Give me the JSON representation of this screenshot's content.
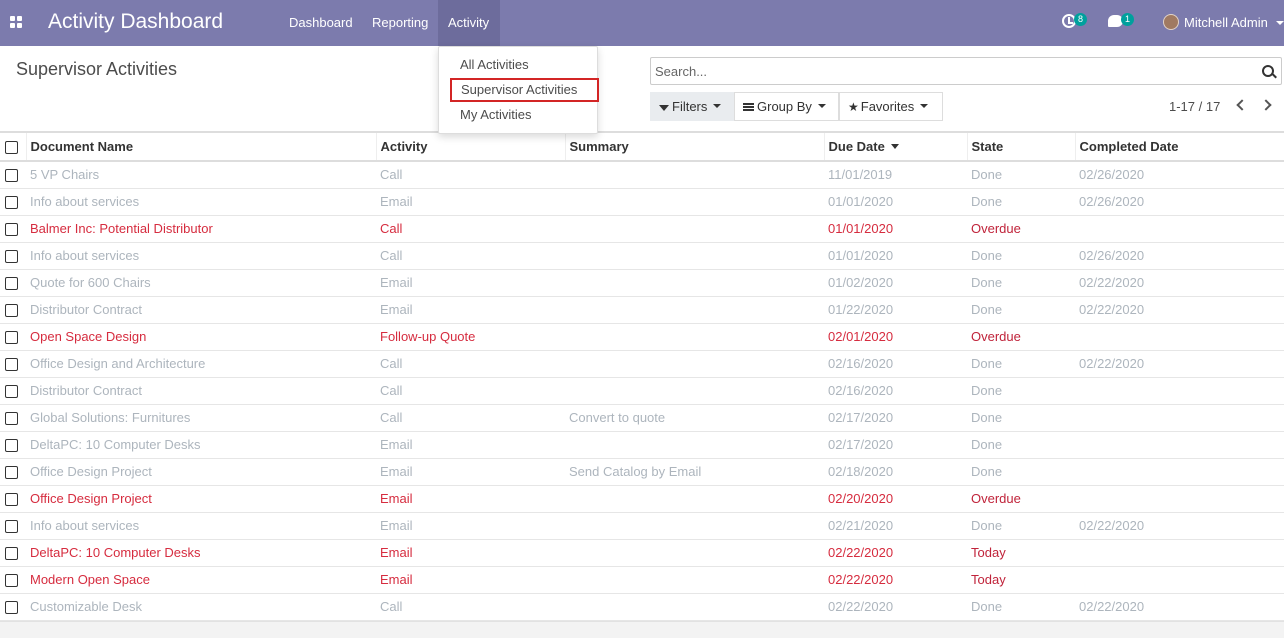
{
  "navbar": {
    "brand": "Activity Dashboard",
    "menu": [
      {
        "label": "Dashboard"
      },
      {
        "label": "Reporting"
      },
      {
        "label": "Activity"
      }
    ],
    "activity_count": "8",
    "message_count": "1",
    "user": "Mitchell Admin"
  },
  "dropdown": {
    "items": [
      {
        "label": "All Activities"
      },
      {
        "label": "Supervisor Activities"
      },
      {
        "label": "My Activities"
      }
    ]
  },
  "control_panel": {
    "title": "Supervisor Activities",
    "search_placeholder": "Search...",
    "filters_label": "Filters",
    "group_by_label": "Group By",
    "favorites_label": "Favorites",
    "pager": "1-17 / 17"
  },
  "table": {
    "columns": [
      "Document Name",
      "Activity",
      "Summary",
      "Due Date",
      "State",
      "Completed Date"
    ],
    "sorted_column": "Due Date",
    "rows": [
      {
        "doc": "5 VP Chairs",
        "activity": "Call",
        "summary": "",
        "due": "11/01/2019",
        "state": "Done",
        "completed": "02/26/2020"
      },
      {
        "doc": "Info about services",
        "activity": "Email",
        "summary": "",
        "due": "01/01/2020",
        "state": "Done",
        "completed": "02/26/2020"
      },
      {
        "doc": "Balmer Inc: Potential Distributor",
        "activity": "Call",
        "summary": "",
        "due": "01/01/2020",
        "state": "Overdue",
        "completed": ""
      },
      {
        "doc": "Info about services",
        "activity": "Call",
        "summary": "",
        "due": "01/01/2020",
        "state": "Done",
        "completed": "02/26/2020"
      },
      {
        "doc": "Quote for 600 Chairs",
        "activity": "Email",
        "summary": "",
        "due": "01/02/2020",
        "state": "Done",
        "completed": "02/22/2020"
      },
      {
        "doc": "Distributor Contract",
        "activity": "Email",
        "summary": "",
        "due": "01/22/2020",
        "state": "Done",
        "completed": "02/22/2020"
      },
      {
        "doc": "Open Space Design",
        "activity": "Follow-up Quote",
        "summary": "",
        "due": "02/01/2020",
        "state": "Overdue",
        "completed": ""
      },
      {
        "doc": "Office Design and Architecture",
        "activity": "Call",
        "summary": "",
        "due": "02/16/2020",
        "state": "Done",
        "completed": "02/22/2020"
      },
      {
        "doc": "Distributor Contract",
        "activity": "Call",
        "summary": "",
        "due": "02/16/2020",
        "state": "Done",
        "completed": ""
      },
      {
        "doc": "Global Solutions: Furnitures",
        "activity": "Call",
        "summary": "Convert to quote",
        "due": "02/17/2020",
        "state": "Done",
        "completed": ""
      },
      {
        "doc": "DeltaPC: 10 Computer Desks",
        "activity": "Email",
        "summary": "",
        "due": "02/17/2020",
        "state": "Done",
        "completed": ""
      },
      {
        "doc": "Office Design Project",
        "activity": "Email",
        "summary": "Send Catalog by Email",
        "due": "02/18/2020",
        "state": "Done",
        "completed": ""
      },
      {
        "doc": "Office Design Project",
        "activity": "Email",
        "summary": "",
        "due": "02/20/2020",
        "state": "Overdue",
        "completed": ""
      },
      {
        "doc": "Info about services",
        "activity": "Email",
        "summary": "",
        "due": "02/21/2020",
        "state": "Done",
        "completed": "02/22/2020"
      },
      {
        "doc": "DeltaPC: 10 Computer Desks",
        "activity": "Email",
        "summary": "",
        "due": "02/22/2020",
        "state": "Today",
        "completed": ""
      },
      {
        "doc": "Modern Open Space",
        "activity": "Email",
        "summary": "",
        "due": "02/22/2020",
        "state": "Today",
        "completed": ""
      },
      {
        "doc": "Customizable Desk",
        "activity": "Call",
        "summary": "",
        "due": "02/22/2020",
        "state": "Done",
        "completed": "02/22/2020"
      }
    ]
  }
}
